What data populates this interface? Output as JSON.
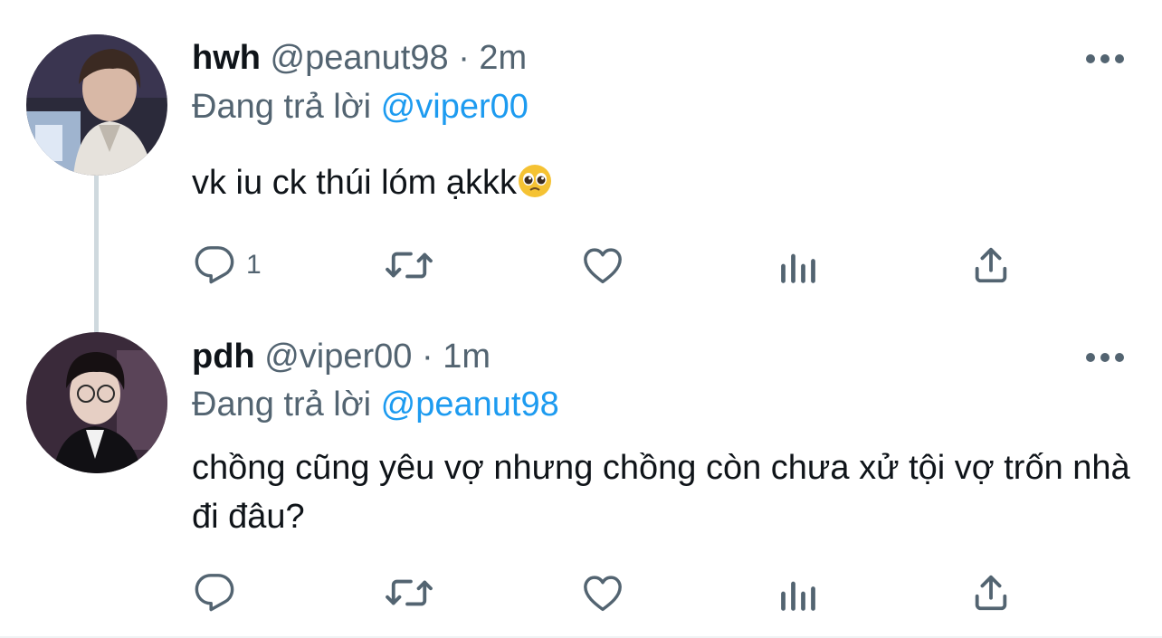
{
  "tweets": [
    {
      "name": "hwh",
      "handle": "@peanut98",
      "separator": "·",
      "time": "2m",
      "reply_prefix": "Đang trả lời",
      "reply_to": "@viper00",
      "text": "vk iu ck thúi lóm ạkkk",
      "emoji": "pleading-face",
      "reply_count": "1"
    },
    {
      "name": "pdh",
      "handle": "@viper00",
      "separator": "·",
      "time": "1m",
      "reply_prefix": "Đang trả lời",
      "reply_to": "@peanut98",
      "text": "chồng cũng yêu vợ nhưng chồng còn chưa xử tội vợ trốn nhà đi đâu?",
      "reply_count": ""
    }
  ],
  "colors": {
    "primary_text": "#0f1419",
    "secondary_text": "#536471",
    "mention": "#1d9bf0",
    "thread_line": "#cfd9de"
  },
  "icons": [
    "more-icon",
    "reply-icon",
    "retweet-icon",
    "like-icon",
    "analytics-icon",
    "share-icon"
  ]
}
